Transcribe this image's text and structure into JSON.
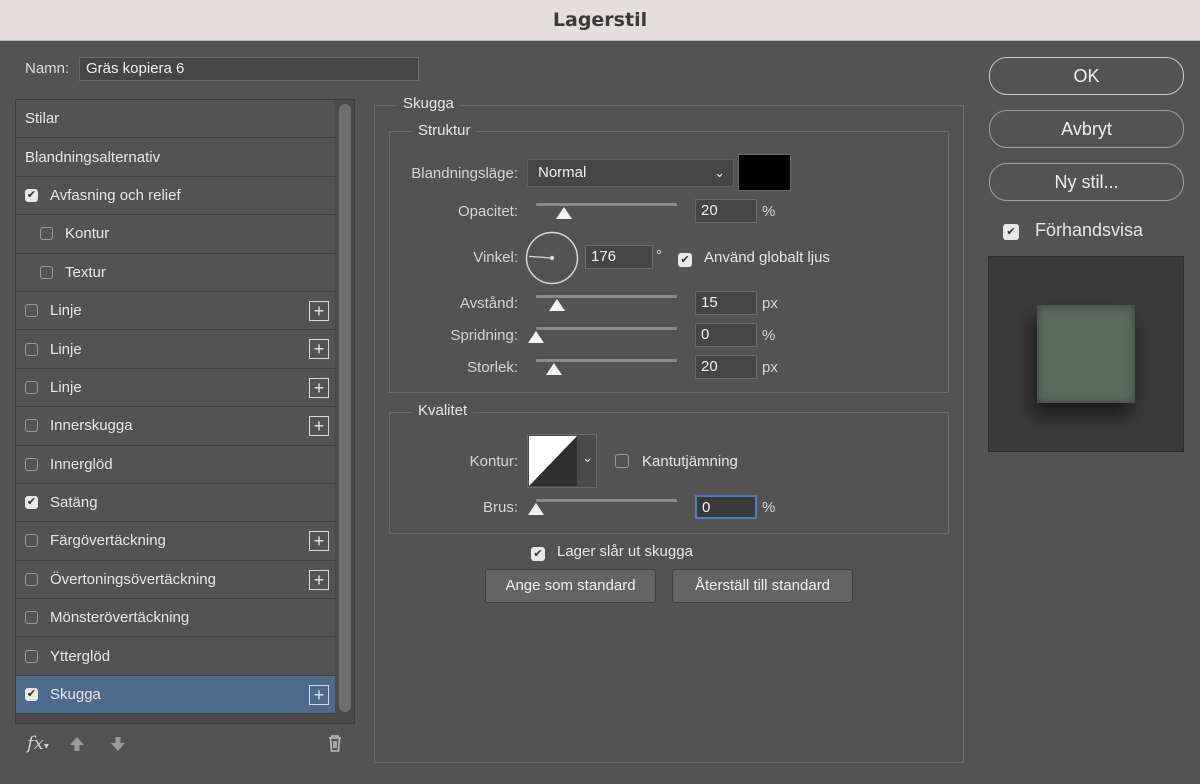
{
  "window": {
    "title": "Lagerstil"
  },
  "name_field": {
    "label": "Namn:",
    "value": "Gräs kopiera 6"
  },
  "styles_list": [
    {
      "label": "Stilar",
      "checkbox": false,
      "checked": false,
      "indent": false,
      "plus": false,
      "selected": false
    },
    {
      "label": "Blandningsalternativ",
      "checkbox": false,
      "checked": false,
      "indent": false,
      "plus": false,
      "selected": false
    },
    {
      "label": "Avfasning och relief",
      "checkbox": true,
      "checked": true,
      "indent": false,
      "plus": false,
      "selected": false
    },
    {
      "label": "Kontur",
      "checkbox": true,
      "checked": false,
      "indent": true,
      "plus": false,
      "selected": false
    },
    {
      "label": "Textur",
      "checkbox": true,
      "checked": false,
      "indent": true,
      "plus": false,
      "selected": false
    },
    {
      "label": "Linje",
      "checkbox": true,
      "checked": false,
      "indent": false,
      "plus": true,
      "selected": false
    },
    {
      "label": "Linje",
      "checkbox": true,
      "checked": false,
      "indent": false,
      "plus": true,
      "selected": false
    },
    {
      "label": "Linje",
      "checkbox": true,
      "checked": false,
      "indent": false,
      "plus": true,
      "selected": false
    },
    {
      "label": "Innerskugga",
      "checkbox": true,
      "checked": false,
      "indent": false,
      "plus": true,
      "selected": false
    },
    {
      "label": "Innerglöd",
      "checkbox": true,
      "checked": false,
      "indent": false,
      "plus": false,
      "selected": false
    },
    {
      "label": "Satäng",
      "checkbox": true,
      "checked": true,
      "indent": false,
      "plus": false,
      "selected": false
    },
    {
      "label": "Färgövertäckning",
      "checkbox": true,
      "checked": false,
      "indent": false,
      "plus": true,
      "selected": false
    },
    {
      "label": "Övertoningsövertäckning",
      "checkbox": true,
      "checked": false,
      "indent": false,
      "plus": true,
      "selected": false
    },
    {
      "label": "Mönsterövertäckning",
      "checkbox": true,
      "checked": false,
      "indent": false,
      "plus": false,
      "selected": false
    },
    {
      "label": "Ytterglöd",
      "checkbox": true,
      "checked": false,
      "indent": false,
      "plus": false,
      "selected": false
    },
    {
      "label": "Skugga",
      "checkbox": true,
      "checked": true,
      "indent": false,
      "plus": true,
      "selected": true
    }
  ],
  "footer": {
    "fx_label": "fx"
  },
  "panel": {
    "title": "Skugga",
    "structure": {
      "title": "Struktur",
      "blend_mode": {
        "label": "Blandningsläge:",
        "value": "Normal",
        "color": "#000000"
      },
      "opacity": {
        "label": "Opacitet:",
        "value": "20",
        "unit": "%",
        "fraction": 0.2
      },
      "angle": {
        "label": "Vinkel:",
        "value": "176",
        "unit": "°",
        "global_light_label": "Använd globalt ljus",
        "global_light_checked": true
      },
      "distance": {
        "label": "Avstånd:",
        "value": "15",
        "unit": "px",
        "fraction": 0.15
      },
      "spread": {
        "label": "Spridning:",
        "value": "0",
        "unit": "%",
        "fraction": 0.0
      },
      "size": {
        "label": "Storlek:",
        "value": "20",
        "unit": "px",
        "fraction": 0.13
      }
    },
    "quality": {
      "title": "Kvalitet",
      "contour": {
        "label": "Kontur:",
        "antialias_label": "Kantutjämning",
        "antialias_checked": false
      },
      "noise": {
        "label": "Brus:",
        "value": "0",
        "unit": "%",
        "fraction": 0.0
      }
    },
    "knockout": {
      "label": "Lager slår ut skugga",
      "checked": true
    },
    "set_default_label": "Ange som standard",
    "reset_default_label": "Återställ till standard"
  },
  "actions": {
    "ok_label": "OK",
    "cancel_label": "Avbryt",
    "new_style_label": "Ny stil...",
    "preview": {
      "label": "Förhandsvisa",
      "checked": true
    }
  },
  "colors": {
    "selected_row": "#4f6b8c",
    "preview_tile": "#5a6b5c"
  }
}
